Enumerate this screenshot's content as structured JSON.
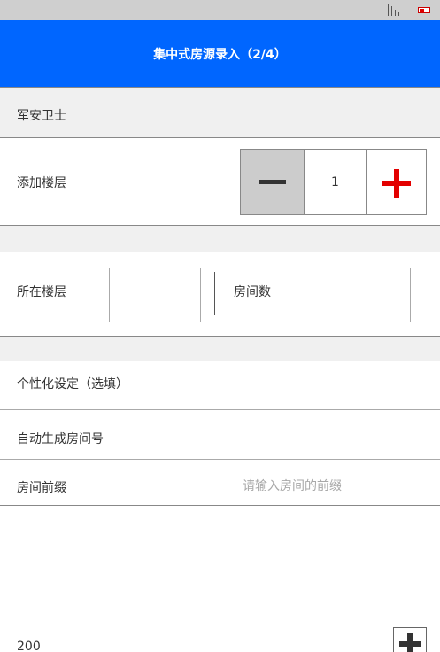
{
  "header": {
    "title": "集中式房源录入（2/4）"
  },
  "building_name": "军安卫士",
  "add_floor": {
    "label": "添加楼层",
    "value": "1"
  },
  "floor_room": {
    "floor_label": "所在楼层",
    "floor_value": "",
    "rooms_label": "房间数",
    "rooms_value": ""
  },
  "custom_settings": {
    "heading": "个性化设定（选填）"
  },
  "auto_generate": {
    "label": "自动生成房间号"
  },
  "room_prefix": {
    "label": "房间前缀",
    "placeholder": "请输入房间的前缀"
  },
  "bottom": {
    "number": "200"
  },
  "colors": {
    "header_bg": "#0066ff",
    "plus_accent": "#e30000",
    "section_gray": "#f0f0f0"
  },
  "icons": {
    "minus": "minus-icon",
    "plus": "plus-icon",
    "signal": "signal-icon",
    "battery": "battery-icon"
  }
}
